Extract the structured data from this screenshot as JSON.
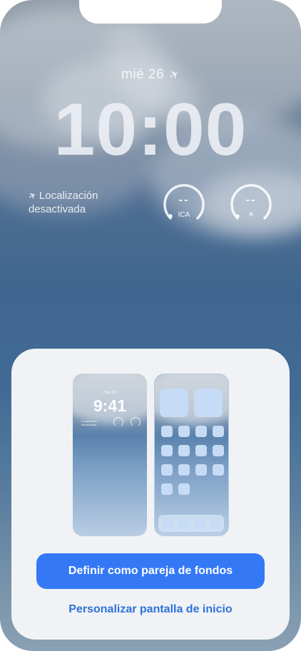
{
  "lockscreen": {
    "date": "mié 26",
    "time": "10:00",
    "location_status": [
      "Localización",
      "desactivada"
    ],
    "widgets": [
      {
        "value": "--",
        "label": "ICA",
        "icon": "dot-icon"
      },
      {
        "value": "--",
        "label": "",
        "icon": "sun-icon"
      }
    ]
  },
  "sheet": {
    "lock_preview": {
      "date": "mié 26",
      "time": "9:41",
      "location_status": [
        "Localización",
        "desactivada"
      ]
    },
    "home_preview": {
      "widget_count": 2,
      "icon_count": 14,
      "dock_icon_count": 4
    },
    "primary_button": "Definir como pareja de fondos",
    "secondary_link": "Personalizar pantalla de inicio"
  },
  "colors": {
    "accent": "#3478f6",
    "link": "#2e72d8",
    "sheet_bg": "#f0f2f5"
  }
}
